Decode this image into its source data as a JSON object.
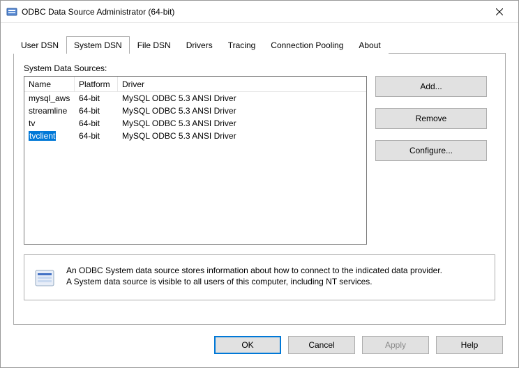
{
  "window": {
    "title": "ODBC Data Source Administrator (64-bit)"
  },
  "tabs": [
    {
      "label": "User DSN"
    },
    {
      "label": "System DSN"
    },
    {
      "label": "File DSN"
    },
    {
      "label": "Drivers"
    },
    {
      "label": "Tracing"
    },
    {
      "label": "Connection Pooling"
    },
    {
      "label": "About"
    }
  ],
  "active_tab_index": 1,
  "section_label": "System Data Sources:",
  "columns": {
    "name": "Name",
    "platform": "Platform",
    "driver": "Driver"
  },
  "rows": [
    {
      "name": "mysql_aws",
      "platform": "64-bit",
      "driver": "MySQL ODBC 5.3 ANSI Driver",
      "selected": false
    },
    {
      "name": "streamline",
      "platform": "64-bit",
      "driver": "MySQL ODBC 5.3 ANSI Driver",
      "selected": false
    },
    {
      "name": "tv",
      "platform": "64-bit",
      "driver": "MySQL ODBC 5.3 ANSI Driver",
      "selected": false
    },
    {
      "name": "tvclient",
      "platform": "64-bit",
      "driver": "MySQL ODBC 5.3 ANSI Driver",
      "selected": true
    }
  ],
  "side_buttons": {
    "add": "Add...",
    "remove": "Remove",
    "configure": "Configure..."
  },
  "info_text_line1": "An ODBC System data source stores information about how to connect to the indicated data provider.",
  "info_text_line2": "A System data source is visible to all users of this computer, including NT services.",
  "dialog_buttons": {
    "ok": "OK",
    "cancel": "Cancel",
    "apply": "Apply",
    "help": "Help"
  }
}
